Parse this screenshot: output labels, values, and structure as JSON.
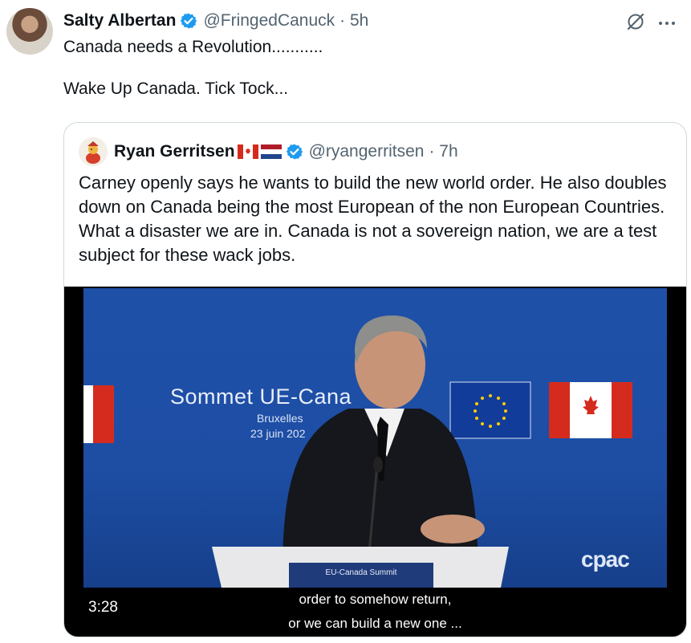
{
  "tweet": {
    "author_name": "Salty Albertan",
    "handle": "@FringedCanuck",
    "time": "· 5h",
    "text_line1": "Canada needs a Revolution...........",
    "text_line2": "Wake Up Canada. Tick Tock...",
    "icons": [
      "avatar",
      "verified-badge-icon",
      "grok-icon",
      "more-options-icon"
    ]
  },
  "quote": {
    "author_name": "Ryan Gerritsen",
    "flags": [
      "canada-flag-icon",
      "netherlands-flag-icon"
    ],
    "handle": "@ryangerritsen",
    "time": "· 7h",
    "text": "Carney openly says he wants to build the new world order. He also doubles down on Canada being the most European of the non European Countries. What a disaster we are in. Canada is not a sovereign nation, we are a test subject for these wack jobs."
  },
  "video": {
    "duration": "3:28",
    "backdrop_title": "Sommet UE-Cana",
    "backdrop_city": "Bruxelles",
    "backdrop_date": "23 juin 202",
    "podium_text": "EU-Canada Summit",
    "watermark": "cpac",
    "caption_line1": "order to somehow return,",
    "caption_line2": "or we can build a new one ...",
    "colors": {
      "backdrop_blue": "#1f50a8",
      "flag_red": "#d52b1e",
      "eu_yellow": "#ffcc00"
    }
  }
}
